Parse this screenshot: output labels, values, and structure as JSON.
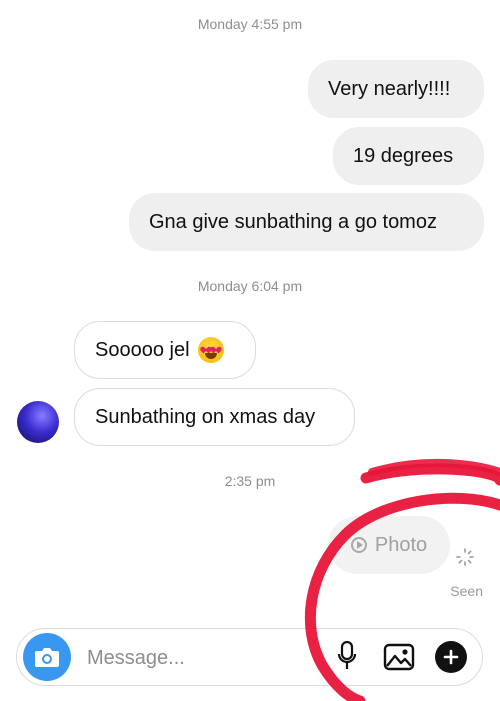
{
  "conversation": {
    "timestamps": [
      "Monday 4:55 pm",
      "Monday 6:04 pm",
      "2:35 pm"
    ],
    "outgoing": [
      "Very nearly!!!!",
      "19 degrees",
      "Gna give sunbathing a go tomoz"
    ],
    "incoming": [
      "Sooooo jel",
      "Sunbathing on xmas day"
    ],
    "photo_label": "Photo",
    "status": "Seen"
  },
  "composer": {
    "placeholder": "Message..."
  },
  "icons": {
    "camera": "camera-icon",
    "microphone": "microphone-icon",
    "gallery": "gallery-icon",
    "plus": "plus-icon",
    "play": "play-icon",
    "emoji": "heart-eyes-emoji-icon",
    "spinner": "loading-spinner-icon"
  },
  "colors": {
    "accent": "#3897f0",
    "annotation": "#e8163a",
    "outgoing_bubble": "#efefef"
  }
}
